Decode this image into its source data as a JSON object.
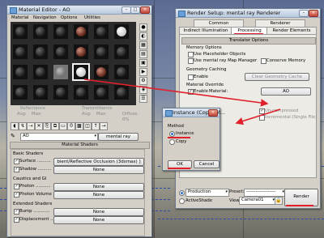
{
  "colors": {
    "accent_red": "#e0202a",
    "window_bg": "#d4d0c8",
    "titlebar": "#c6d4e6"
  },
  "material_editor": {
    "title": "Material Editor - AO",
    "menu": [
      "Material",
      "Navigation",
      "Options",
      "Utilities"
    ],
    "param_labels": {
      "reflectance": "Reflectance",
      "transmittance": "Transmittance",
      "avg": "Avg:",
      "max": "Max:",
      "diffuse": "Diffuse",
      "zero_pct": "0%"
    },
    "material_name": "AO",
    "material_type": "mental ray",
    "shaders_header": "Material Shaders",
    "basic_header": "Basic Shaders",
    "surface_label": "Surface ..........",
    "surface_value": "bient/Reflective Occlusion (3dsmax) ]",
    "shadow_label": "Shadow ..........",
    "shadow_value": "None",
    "caustics_header": "Caustics and GI",
    "photon_label": "Photon ...........",
    "photon_value": "None",
    "photon_volume_label": "Photon Volume ..",
    "photon_volume_value": "None",
    "extended_header": "Extended Shaders",
    "bump_label": "Bump ............",
    "bump_value": "None",
    "displacement_label": "Displacement ...",
    "displacement_value": "None"
  },
  "render_setup": {
    "title": "Render Setup: mental ray Renderer",
    "tabs_row1": [
      "Common",
      "Renderer"
    ],
    "tabs_row2": [
      "Indirect Illumination",
      "Processing",
      "Render Elements"
    ],
    "rollout": "Translator Options",
    "memory_options": "Memory Options",
    "use_placeholder": "Use Placeholder Objects",
    "use_map_manager": "Use mental ray Map Manager",
    "conserve_memory": "Conserve Memory",
    "geometry_caching": "Geometry Caching",
    "enable": "Enable",
    "clear_cache": "Clear Geometry Cache",
    "material_override": "Material Override",
    "material_override_enable": "Enable",
    "material_label": "Material:",
    "material_value": "AO",
    "uncompressed": "Un-compressed",
    "incremental": "Incremental (Single File)",
    "production": "Production",
    "preset_label": "Preset:",
    "preset_value": "-------------------",
    "activeshade": "ActiveShade",
    "view_label": "View:",
    "view_value": "Camera01",
    "render_button": "Render"
  },
  "instance_dialog": {
    "title": "Instance (Copy) M...",
    "method_label": "Method",
    "instance_option": "Instance",
    "copy_option": "Copy",
    "selected": "Instance",
    "ok": "OK",
    "cancel": "Cancel"
  }
}
